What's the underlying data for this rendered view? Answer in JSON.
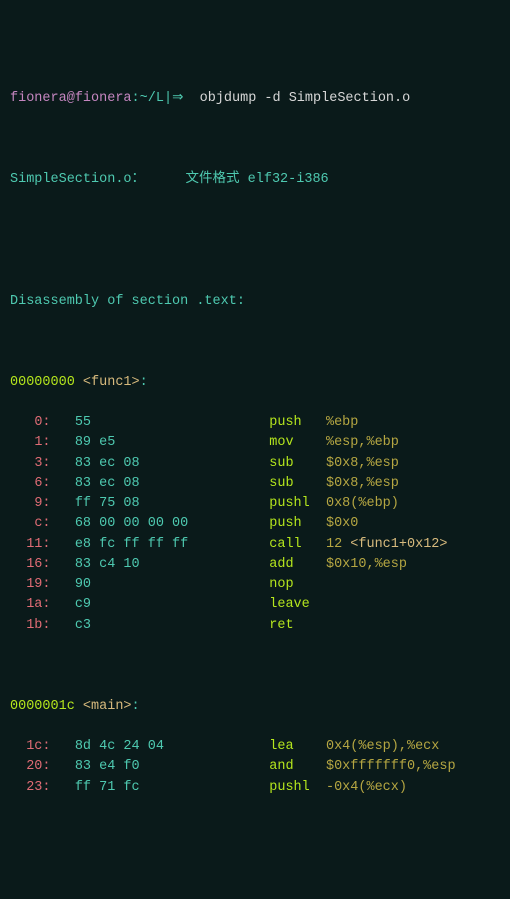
{
  "prompt": {
    "user": "fionera",
    "at": "@",
    "host": "fionera",
    "colon": ":",
    "path": "~/L",
    "bar": "|",
    "arrow": "⇒  ",
    "command": "objdump -d SimpleSection.o"
  },
  "file_header": {
    "name": "SimpleSection.o：",
    "spacer": "     ",
    "format": "文件格式 elf32-i386"
  },
  "section_header": "Disassembly of section .text:",
  "func1": {
    "label_addr": "00000000 ",
    "label_name": "<func1>",
    "label_colon": ":",
    "rows": [
      {
        "pad": "   ",
        "addr": "0:",
        "hex": "   55                   ",
        "mnem": "   push   ",
        "ops": "%ebp"
      },
      {
        "pad": "   ",
        "addr": "1:",
        "hex": "   89 e5                ",
        "mnem": "   mov    ",
        "ops": "%esp,%ebp"
      },
      {
        "pad": "   ",
        "addr": "3:",
        "hex": "   83 ec 08             ",
        "mnem": "   sub    ",
        "ops": "$0x8,%esp"
      },
      {
        "pad": "   ",
        "addr": "6:",
        "hex": "   83 ec 08             ",
        "mnem": "   sub    ",
        "ops": "$0x8,%esp"
      },
      {
        "pad": "   ",
        "addr": "9:",
        "hex": "   ff 75 08             ",
        "mnem": "   pushl  ",
        "ops": "0x8(%ebp)"
      },
      {
        "pad": "   ",
        "addr": "c:",
        "hex": "   68 00 00 00 00       ",
        "mnem": "   push   ",
        "ops": "$0x0"
      },
      {
        "pad": "  ",
        "addr": "11:",
        "hex": "   e8 fc ff ff ff       ",
        "mnem": "   call   ",
        "ops": "12 ",
        "ref": "<func1+0x12>"
      },
      {
        "pad": "  ",
        "addr": "16:",
        "hex": "   83 c4 10             ",
        "mnem": "   add    ",
        "ops": "$0x10,%esp"
      },
      {
        "pad": "  ",
        "addr": "19:",
        "hex": "   90                   ",
        "mnem": "   nop",
        "ops": ""
      },
      {
        "pad": "  ",
        "addr": "1a:",
        "hex": "   c9                   ",
        "mnem": "   leave",
        "ops": ""
      },
      {
        "pad": "  ",
        "addr": "1b:",
        "hex": "   c3                   ",
        "mnem": "   ret",
        "ops": ""
      }
    ]
  },
  "main": {
    "label_addr": "0000001c ",
    "label_name": "<main>",
    "label_colon": ":",
    "rows": [
      {
        "pad": "  ",
        "addr": "1c:",
        "hex": "   8d 4c 24 04          ",
        "mnem": "   lea    ",
        "ops": "0x4(%esp),%ecx"
      },
      {
        "pad": "  ",
        "addr": "20:",
        "hex": "   83 e4 f0             ",
        "mnem": "   and    ",
        "ops": "$0xfffffff0,%esp"
      },
      {
        "pad": "  ",
        "addr": "23:",
        "hex": "   ff 71 fc             ",
        "mnem": "   pushl  ",
        "ops": "-0x4(%ecx)"
      }
    ]
  }
}
